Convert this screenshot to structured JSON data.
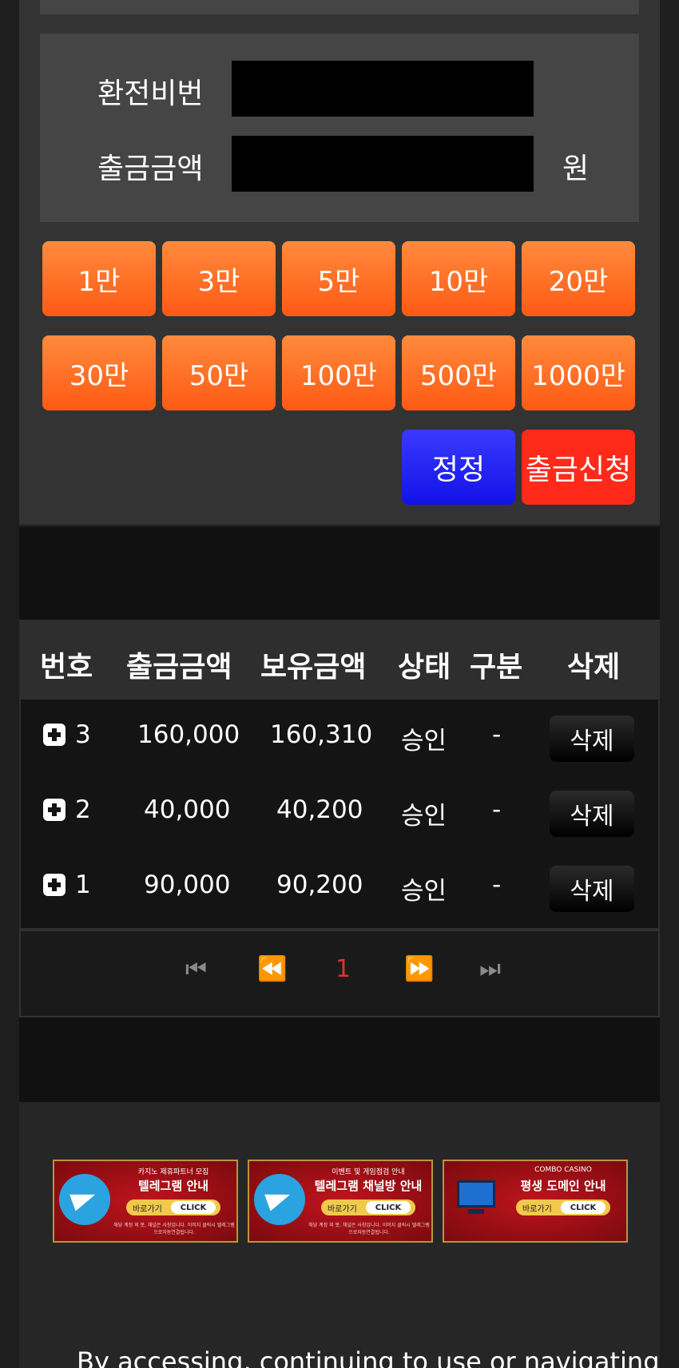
{
  "form": {
    "pin_label": "환전비번",
    "amount_label": "출금금액",
    "amount_unit": "원"
  },
  "amount_buttons": [
    "1만",
    "3만",
    "5만",
    "10만",
    "20만",
    "30만",
    "50만",
    "100만",
    "500만",
    "1000만"
  ],
  "actions": {
    "correct_label": "정정",
    "submit_label": "출금신청"
  },
  "table": {
    "headers": [
      "번호",
      "출금금액",
      "보유금액",
      "상태",
      "구분",
      "삭제"
    ],
    "rows": [
      {
        "no": "3",
        "withdraw": "160,000",
        "balance": "160,310",
        "status": "승인",
        "type": "-",
        "delete": "삭제"
      },
      {
        "no": "2",
        "withdraw": "40,000",
        "balance": "40,200",
        "status": "승인",
        "type": "-",
        "delete": "삭제"
      },
      {
        "no": "1",
        "withdraw": "90,000",
        "balance": "90,200",
        "status": "승인",
        "type": "-",
        "delete": "삭제"
      }
    ]
  },
  "pagination": {
    "first": "⏮",
    "prev": "⏪",
    "current": "1",
    "next": "⏩",
    "last": "⏭"
  },
  "banners": [
    {
      "small": "카지노 제휴파트너 모집",
      "title": "텔레그램 안내",
      "pill_left": "바로가기",
      "pill_right": "CLICK",
      "note": "해당 계정 외 봇, 채널은 사칭입니다. 이미지 클릭시 텔레그램으로자동연결됩니다.",
      "icon": "telegram-icon"
    },
    {
      "small": "이벤트 및 게임점검 안내",
      "title": "텔레그램 채널방 안내",
      "pill_left": "바로가기",
      "pill_right": "CLICK",
      "note": "해당 계정 외 봇, 채널은 사칭입니다. 이미지 클릭시 텔레그램으로자동연결됩니다.",
      "icon": "telegram-icon"
    },
    {
      "small": "COMBO CASINO",
      "title": "평생 도메인 안내",
      "pill_left": "바로가기",
      "pill_right": "CLICK",
      "icon": "monitor-icon"
    }
  ],
  "footer": {
    "legal_text": "By accessing, continuing to use or navigating"
  },
  "colors": {
    "accent_orange": "#ff6a1f",
    "correct_blue": "#1a1aff",
    "submit_red": "#ff2a1a",
    "active_page": "#e03030"
  }
}
